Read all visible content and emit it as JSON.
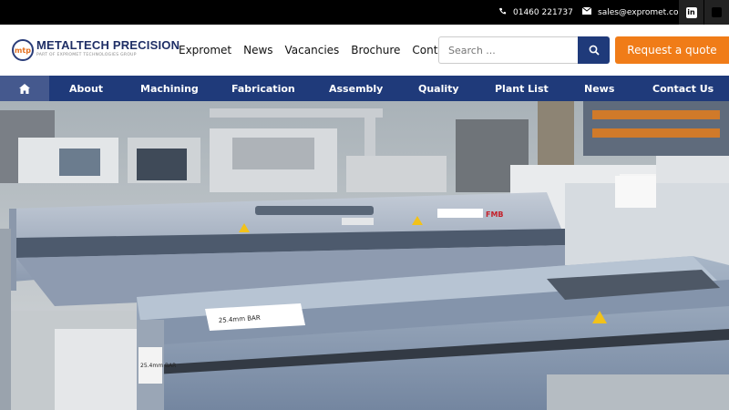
{
  "topbar": {
    "phone": "01460 221737",
    "email": "sales@expromet.com",
    "icons": [
      "phone-icon",
      "mail-icon",
      "linkedin-icon",
      "x-icon"
    ]
  },
  "logo": {
    "mark": "mtp",
    "name": "METALTECH PRECISION",
    "tagline": "PART OF EXPROMET TECHNOLOGIES GROUP"
  },
  "main_nav": [
    "Expromet",
    "News",
    "Vacancies",
    "Brochure",
    "Contact"
  ],
  "search": {
    "placeholder": "Search ..."
  },
  "quote_button": "Request a quote",
  "nav": [
    "About",
    "Machining",
    "Fabrication",
    "Assembly",
    "Quality",
    "Plant List",
    "News",
    "Contact Us"
  ],
  "hero": {
    "machine_label_1": "FMB",
    "bar_label_1": "25.4mm BAR",
    "bar_label_2": "25.4mm BAR"
  },
  "colors": {
    "topbar": "#000000",
    "navbar": "#1f3a7a",
    "accent": "#f07c18",
    "home_tile": "#45598e"
  }
}
